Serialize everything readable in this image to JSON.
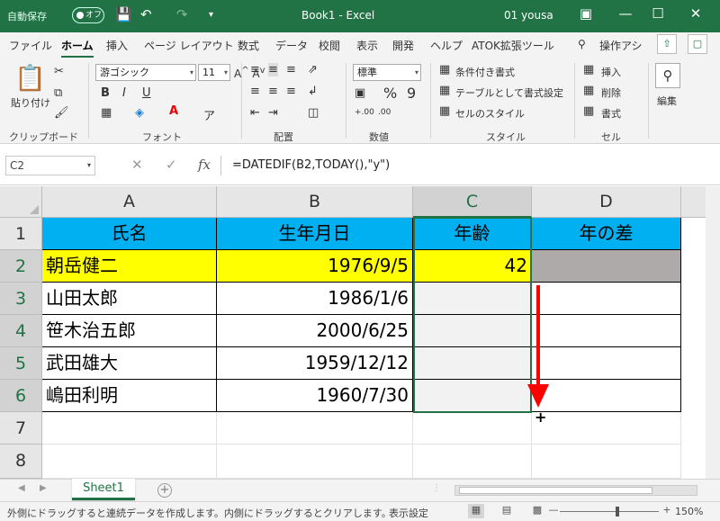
{
  "titlebar": {
    "autosave_label": "自動保存",
    "autosave_state": "オフ",
    "doc_title": "Book1  -  Excel",
    "user": "01 yousa"
  },
  "tabs": [
    "ファイル",
    "ホーム",
    "挿入",
    "ページ レイアウト",
    "数式",
    "データ",
    "校閲",
    "表示",
    "開発",
    "ヘルプ",
    "ATOK拡張ツール",
    "操作アシ"
  ],
  "active_tab": "ホーム",
  "ribbon": {
    "clipboard": {
      "paste": "貼り付け",
      "label": "クリップボード"
    },
    "font": {
      "name": "游ゴシック",
      "size": "11",
      "label": "フォント",
      "bold": "B",
      "italic": "I",
      "underline": "U"
    },
    "alignment": {
      "label": "配置"
    },
    "number": {
      "format": "標準",
      "percent": "%",
      "comma": "9",
      "label": "数値"
    },
    "styles": {
      "conditional": "条件付き書式",
      "table": "テーブルとして書式設定",
      "cell": "セルのスタイル",
      "label": "スタイル"
    },
    "cells": {
      "insert": "挿入",
      "delete": "削除",
      "format": "書式",
      "label": "セル"
    },
    "editing": {
      "label": "編集"
    }
  },
  "formula_bar": {
    "name_box": "C2",
    "formula": "=DATEDIF(B2,TODAY(),\"y\")"
  },
  "columns": [
    "A",
    "B",
    "C",
    "D"
  ],
  "rows": [
    "1",
    "2",
    "3",
    "4",
    "5",
    "6",
    "7",
    "8"
  ],
  "table": {
    "headers": [
      "氏名",
      "生年月日",
      "年齢",
      "年の差"
    ],
    "rows": [
      [
        "朝岳健二",
        "1976/9/5",
        "42",
        ""
      ],
      [
        "山田太郎",
        "1986/1/6",
        "",
        ""
      ],
      [
        "笹木治五郎",
        "2000/6/25",
        "",
        ""
      ],
      [
        "武田雄大",
        "1959/12/12",
        "",
        ""
      ],
      [
        "嶋田利明",
        "1960/7/30",
        "",
        ""
      ]
    ]
  },
  "colors": {
    "header_fill": "#00b0f0",
    "highlight_row": "#ffff00",
    "gray_cell": "#aeaaaa",
    "excel_green": "#217346",
    "arrow": "#ff0000"
  },
  "sheet_tab": "Sheet1",
  "statusbar": {
    "message": "外側にドラッグすると連続データを作成します。内側にドラッグするとクリアします。",
    "display_settings": "表示設定",
    "zoom": "150%"
  }
}
